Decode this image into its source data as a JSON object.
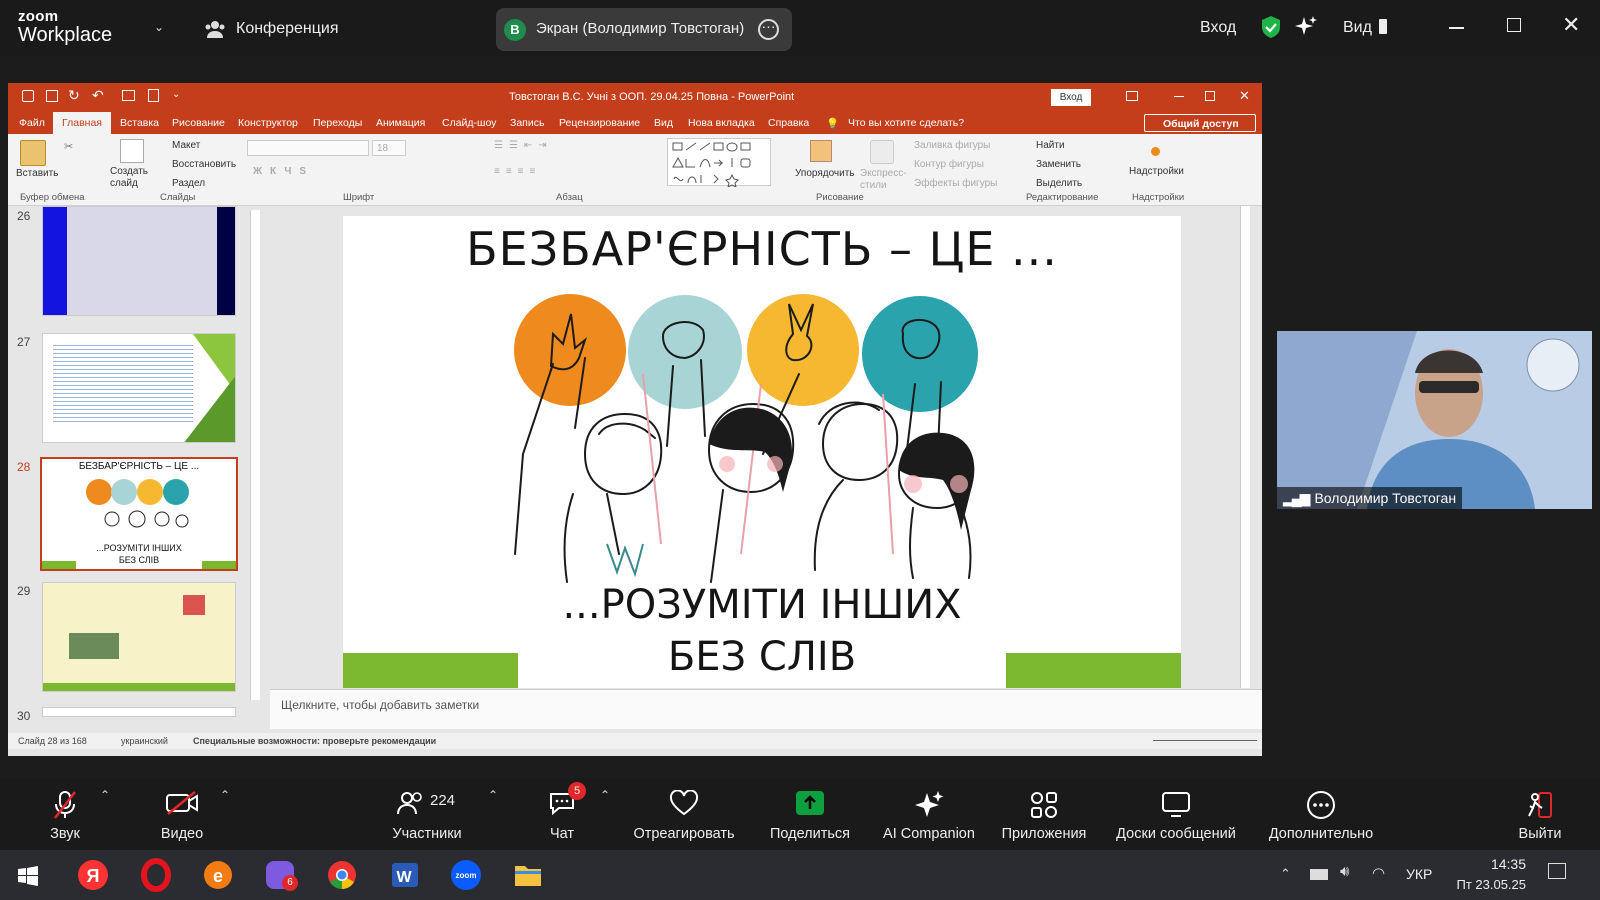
{
  "zoom": {
    "brand_top": "zoom",
    "brand_bottom": "Workplace",
    "meeting_label": "Конференция",
    "share_avatar": "В",
    "share_label": "Экран (Володимир Товстоган)",
    "signin": "Вход",
    "view": "Вид"
  },
  "ppt": {
    "title": "Товстоган В.С. Учні з ООП. 29.04.25 Повна  -  PowerPoint",
    "signin": "Вход",
    "share": "Общий доступ",
    "tabs": [
      "Файл",
      "Главная",
      "Вставка",
      "Рисование",
      "Конструктор",
      "Переходы",
      "Анимация",
      "Слайд-шоу",
      "Запись",
      "Рецензирование",
      "Вид",
      "Нова вкладка",
      "Справка"
    ],
    "tell_me": "Что вы хотите сделать?",
    "ribbon": {
      "paste": "Вставить",
      "new_slide": "Создать слайд",
      "layout": "Макет",
      "reset": "Восстановить",
      "section": "Раздел",
      "font_size": "18",
      "arrange": "Упорядочить",
      "quick_styles": "Экспресс-стили",
      "fill": "Заливка фигуры",
      "outline": "Контур фигуры",
      "effects": "Эффекты фигуры",
      "find": "Найти",
      "replace": "Заменить",
      "select": "Выделить",
      "addins": "Надстройки",
      "groups": {
        "clipboard": "Буфер обмена",
        "slides": "Слайды",
        "font": "Шрифт",
        "paragraph": "Абзац",
        "drawing": "Рисование",
        "editing": "Редактирование",
        "addins": "Надстройки"
      }
    },
    "thumbs": [
      {
        "num": "26"
      },
      {
        "num": "27"
      },
      {
        "num": "28"
      },
      {
        "num": "29"
      },
      {
        "num": "30"
      }
    ],
    "slide": {
      "top": "БЕЗБАР'ЄРНІСТЬ – ЦЕ ...",
      "bottom1": "...РОЗУМІТИ ІНШИХ",
      "bottom2": "БЕЗ СЛІВ"
    },
    "thumb28": {
      "top": "БЕЗБАР'ЄРНІСТЬ – ЦЕ ...",
      "bottom1": "...РОЗУМІТИ ІНШИХ",
      "bottom2": "БЕЗ СЛІВ"
    },
    "notes": "Щелкните, чтобы добавить заметки",
    "status": {
      "slide": "Слайд 28 из 168",
      "lang": "украинский",
      "access": "Специальные возможности: проверьте рекомендации"
    }
  },
  "video": {
    "name": "Володимир Товстоган"
  },
  "toolbar": {
    "audio": "Звук",
    "video": "Видео",
    "participants": "Участники",
    "participants_count": "224",
    "chat": "Чат",
    "chat_badge": "5",
    "react": "Отреагировать",
    "share": "Поделиться",
    "ai": "AI Companion",
    "apps": "Приложения",
    "boards": "Доски сообщений",
    "more": "Дополнительно",
    "leave": "Выйти"
  },
  "taskbar": {
    "lang": "УКР",
    "time": "14:35",
    "date": "Пт 23.05.25",
    "viber_badge": "6"
  },
  "colors": {
    "ppt_red": "#c43e1c",
    "slide_green": "#7cb82f",
    "share_green": "#0e9f3e",
    "leave_red": "#e02828"
  }
}
